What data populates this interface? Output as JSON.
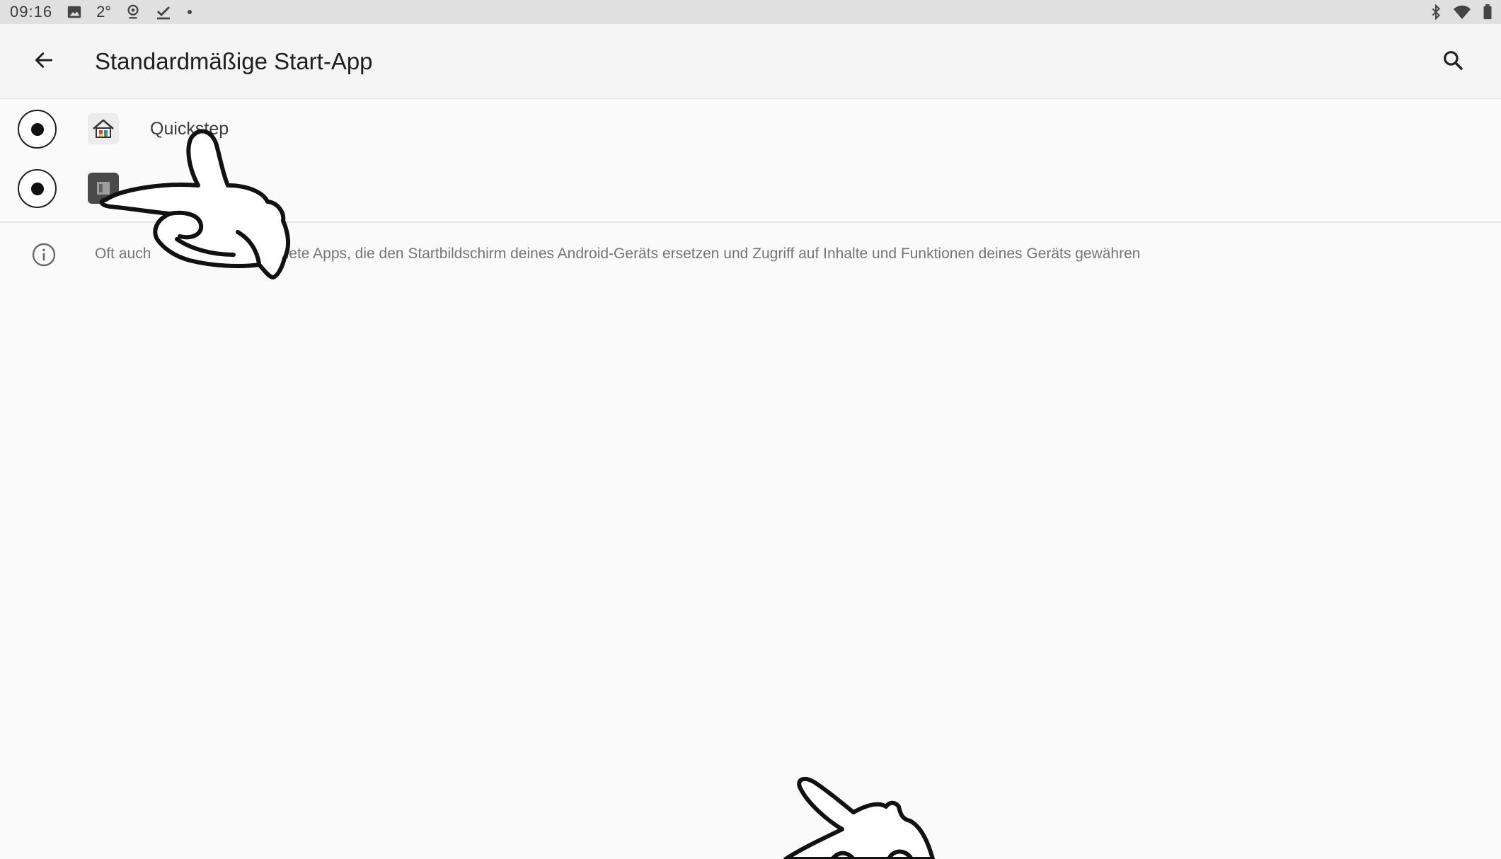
{
  "status_bar": {
    "time": "09:16",
    "temperature": "2°",
    "icons_left": [
      "image-icon",
      "location-icon",
      "download-done-icon",
      "dot-icon"
    ],
    "icons_right": [
      "bluetooth-icon",
      "wifi-icon",
      "battery-icon"
    ]
  },
  "app_bar": {
    "title": "Standardmäßige Start-App",
    "back_icon": "arrow-back-icon",
    "search_icon": "search-icon"
  },
  "apps": [
    {
      "label": "Quickstep",
      "icon": "home-icon",
      "selected": true
    },
    {
      "label": "",
      "icon": "app-icon",
      "selected": true
    }
  ],
  "info": {
    "icon": "info-icon",
    "text": "Oft auch                     ezeichnete Apps, die den Startbildschirm deines Android-Geräts ersetzen und Zugriff auf Inhalte und Funktionen deines Geräts gewähren"
  },
  "overlay": {
    "pointer_hands": [
      "pointing-hand",
      "pointing-hand-partial"
    ]
  }
}
